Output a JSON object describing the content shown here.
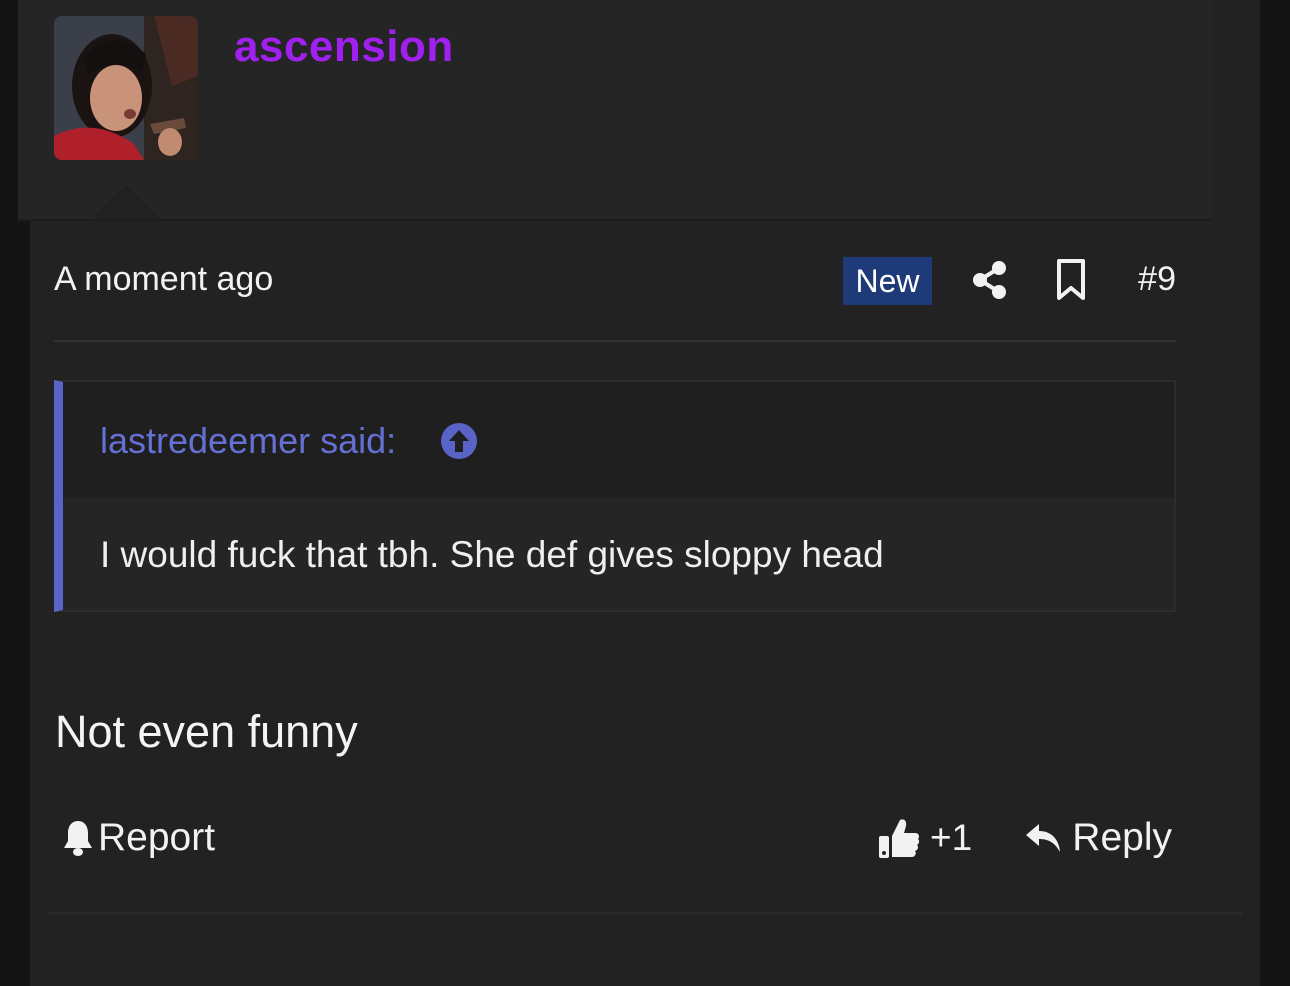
{
  "user": {
    "username": "ascension",
    "username_color": "#a020f0",
    "avatar_icon": "user-avatar-photo"
  },
  "post": {
    "timestamp": "A moment ago",
    "badge": "New",
    "share_icon": "share-icon",
    "bookmark_icon": "bookmark-icon",
    "number": "#9",
    "message": "Not even funny"
  },
  "quote": {
    "author_line": "lastredeemer said:",
    "jump_icon": "arrow-up-circle-icon",
    "text": "I would fuck that tbh. She def gives sloppy head",
    "accent_color": "#5a64c8"
  },
  "actions": {
    "report_label": "Report",
    "reaction_count": "+1",
    "reply_label": "Reply"
  },
  "colors": {
    "background": "#222222",
    "badge": "#1f3a78"
  }
}
